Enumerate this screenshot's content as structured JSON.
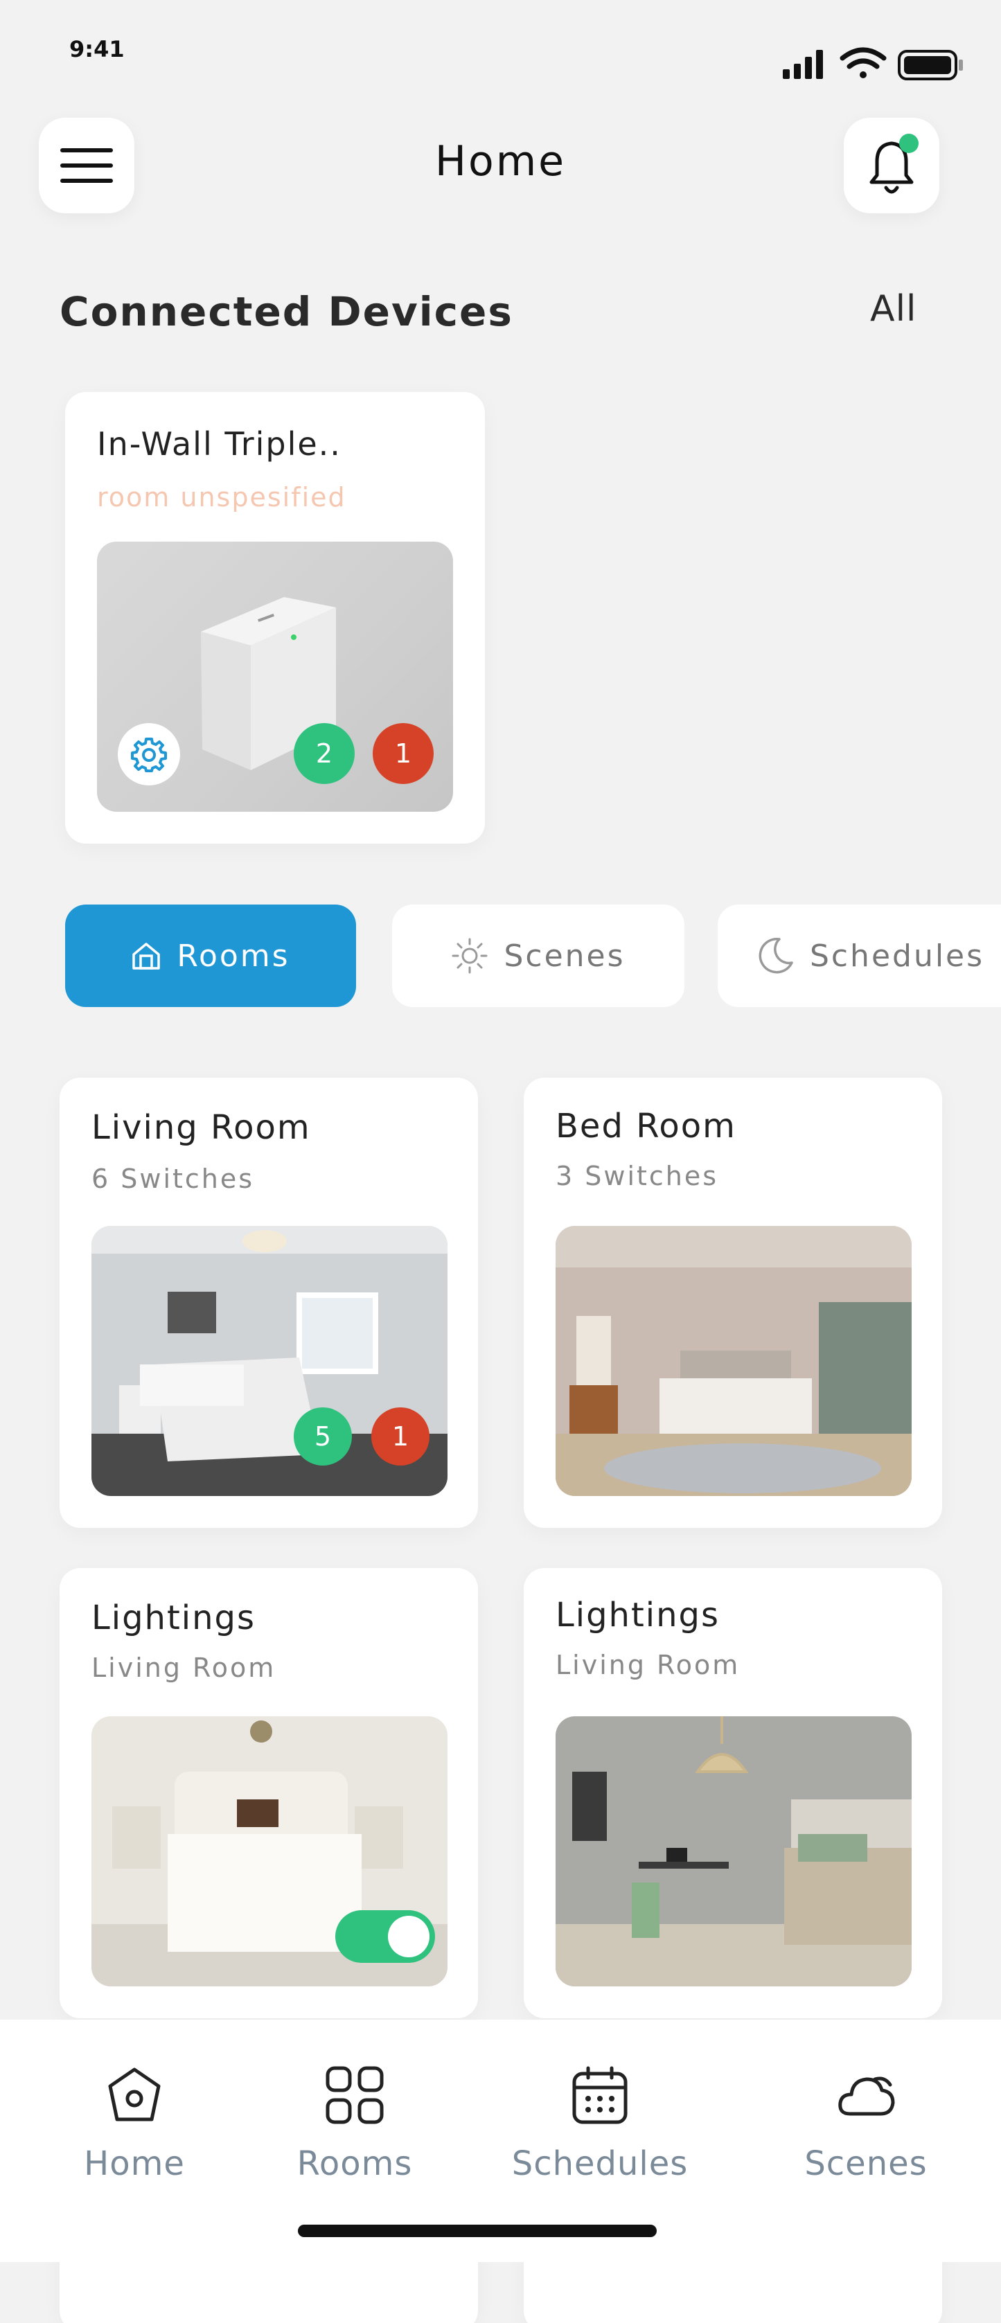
{
  "status_bar": {
    "time": "9:41"
  },
  "header": {
    "title": "Home",
    "menu_icon": "menu-icon",
    "bell_icon": "bell-icon",
    "notification_dot_color": "#2ec27e"
  },
  "connected_devices": {
    "title": "Connected Devices",
    "see_all": "All",
    "device": {
      "name": "In-Wall Triple..",
      "room": "room unspesified",
      "active_count": "2",
      "inactive_count": "1"
    }
  },
  "tabs": [
    {
      "label": "Rooms",
      "icon": "home-outline-icon",
      "active": true
    },
    {
      "label": "Scenes",
      "icon": "sun-icon",
      "active": false
    },
    {
      "label": "Schedules",
      "icon": "moon-icon",
      "active": false
    }
  ],
  "rooms": [
    {
      "title": "Living Room",
      "subtitle": "6 Switches",
      "badge_active": "5",
      "badge_inactive": "1"
    },
    {
      "title": "Bed Room",
      "subtitle": "3 Switches"
    },
    {
      "title": "Lightings",
      "subtitle": "Living Room",
      "toggle_on": true
    },
    {
      "title": "Lightings",
      "subtitle": "Living Room"
    }
  ],
  "bottom_nav": [
    {
      "label": "Home",
      "icon": "home-icon"
    },
    {
      "label": "Rooms",
      "icon": "grid-icon"
    },
    {
      "label": "Schedules",
      "icon": "calendar-icon"
    },
    {
      "label": "Scenes",
      "icon": "cloud-icon"
    }
  ],
  "colors": {
    "accent": "#1e97d4",
    "green": "#2ec27e",
    "red": "#d64227",
    "background": "#f2f2f2"
  }
}
